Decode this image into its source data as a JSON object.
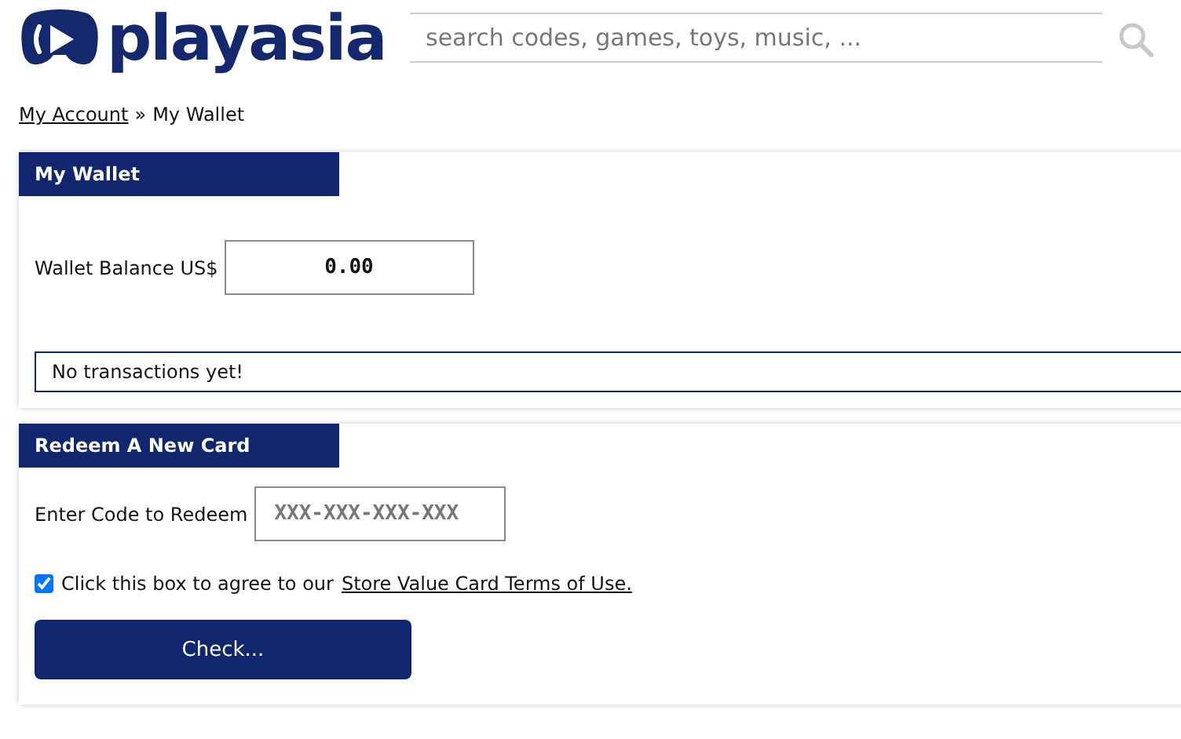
{
  "header": {
    "logo": "playasia",
    "search": {
      "placeholder": "search codes, games, toys, music, ..."
    }
  },
  "breadcrumb": [
    {
      "label": "My Account",
      "kind": "link"
    },
    {
      "label": "»",
      "kind": "separator"
    },
    {
      "label": "My Wallet",
      "kind": "text"
    }
  ],
  "wallet": {
    "title": "My Wallet",
    "balance_label": "Wallet Balance US$",
    "balance": "0.00",
    "transactions": "No transactions yet!"
  },
  "redeem": {
    "title": "Redeem A New Card",
    "code_label": "Enter Code to Redeem",
    "code_placeholder": "XXX-XXX-XXX-XXX",
    "agree": {
      "checked": true,
      "text": "Click this box to agree to our",
      "link": "Store Value Card Terms of Use."
    },
    "button": "Check..."
  }
}
